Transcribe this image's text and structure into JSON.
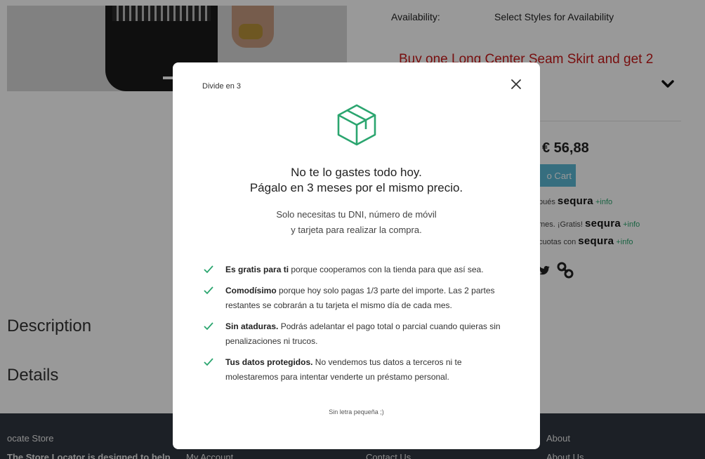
{
  "product": {
    "availability_label": "Availability:",
    "availability_value": "Select Styles for Availability",
    "promo_text": "Buy one Long Center Seam Skirt and get 2",
    "price": "€ 56,88",
    "add_to_cart_label": "o Cart"
  },
  "sequra_options": [
    {
      "prefix": "pués",
      "brand": "sequra",
      "info": "+info"
    },
    {
      "prefix": "mes. ¡Gratis!",
      "brand": "sequra",
      "info": "+info"
    },
    {
      "prefix": "cuotas con",
      "brand": "sequra",
      "info": "+info"
    }
  ],
  "sections": {
    "description": "Description",
    "details": "Details"
  },
  "footer": {
    "col1_title": "ocate Store",
    "col1_text": "The Store Locator is designed to help",
    "col2_link": "My Account",
    "col3_link": "Contact Us",
    "col4_title": "About",
    "col4_link": "About Us"
  },
  "modal": {
    "eyebrow": "Divide en 3",
    "headline_line1": "No te lo gastes todo hoy.",
    "headline_line2": "Págalo en 3 meses por el mismo precio.",
    "subhead_line1": "Solo necesitas tu DNI, número de móvil",
    "subhead_line2": "y tarjeta para realizar la compra.",
    "features": [
      {
        "bold": "Es gratis para ti",
        "text": " porque cooperamos con la tienda para que así sea."
      },
      {
        "bold": "Comodísimo",
        "text": " porque hoy solo pagas 1/3 parte del importe. Las 2 partes restantes se cobrarán a tu tarjeta el mismo día de cada mes."
      },
      {
        "bold": "Sin ataduras.",
        "text": " Podrás adelantar el pago total o parcial cuando quieras sin penalizaciones ni trucos."
      },
      {
        "bold": "Tus datos protegidos.",
        "text": " No vendemos tus datos a terceros ni te molestaremos para intentar venderte un préstamo personal."
      }
    ],
    "fineprint": "Sin letra pequeña ;)",
    "icons": {
      "close": "close-icon",
      "cube": "cube-icon",
      "check": "check-icon"
    }
  },
  "colors": {
    "accent_green": "#2ba56f",
    "promo_red": "#c91a1a",
    "cart_blue": "#5bb8d4",
    "footer_bg": "#2f3640"
  }
}
